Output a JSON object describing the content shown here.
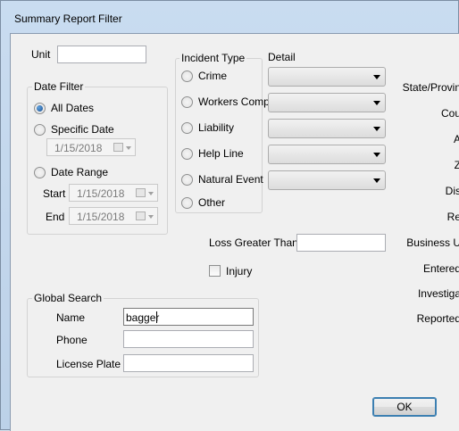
{
  "window": {
    "title": "Summary Report Filter"
  },
  "unit": {
    "label": "Unit",
    "value": ""
  },
  "date_filter": {
    "legend": "Date Filter",
    "all_dates": "All Dates",
    "specific_date": "Specific Date",
    "specific_date_value": "1/15/2018",
    "date_range": "Date Range",
    "start_label": "Start",
    "start_value": "1/15/2018",
    "end_label": "End",
    "end_value": "1/15/2018",
    "selected": "All Dates"
  },
  "incident_type": {
    "legend": "Incident Type",
    "options": [
      "Crime",
      "Workers Comp",
      "Liability",
      "Help Line",
      "Natural Event",
      "Other"
    ]
  },
  "detail": {
    "label": "Detail"
  },
  "loss_greater_than": {
    "label": "Loss Greater Than",
    "value": ""
  },
  "injury": {
    "label": "Injury",
    "checked": false
  },
  "global_search": {
    "legend": "Global Search",
    "name_label": "Name",
    "name_value": "bagger",
    "phone_label": "Phone",
    "phone_value": "",
    "plate_label": "License Plate",
    "plate_value": ""
  },
  "right_column": {
    "labels": [
      "State/Provin",
      "Cou",
      "A",
      "Z",
      "Dis",
      "Re",
      "Business U",
      "Entered",
      "Investiga",
      "Reported"
    ]
  },
  "buttons": {
    "ok": "OK"
  }
}
